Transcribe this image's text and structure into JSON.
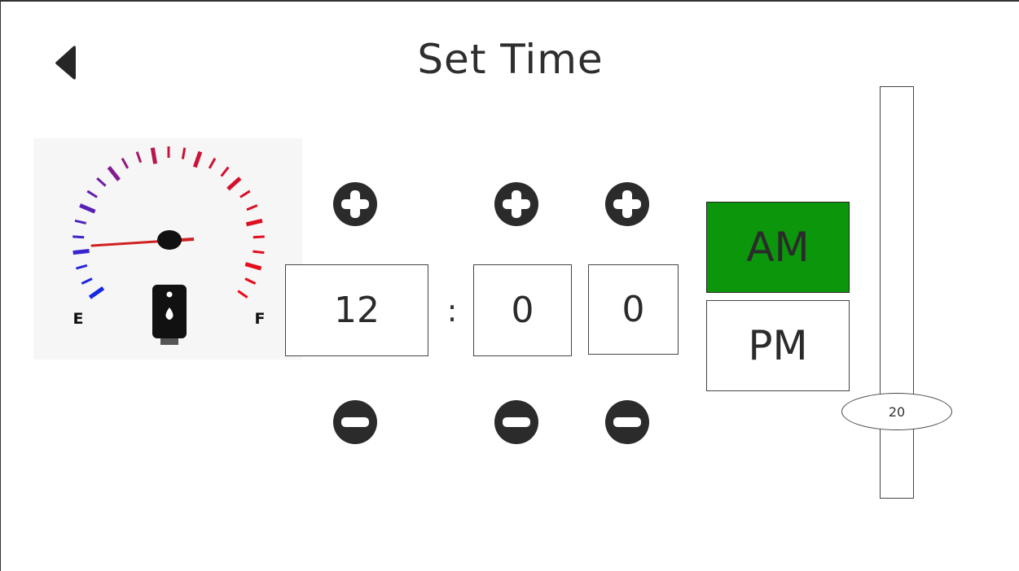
{
  "header": {
    "title": "Set Time",
    "back_icon": "back-arrow-icon"
  },
  "gauge": {
    "empty_label": "E",
    "full_label": "F",
    "icon": "fuel-tank-icon",
    "level": 0.05
  },
  "time": {
    "hour": "12",
    "separator": ":",
    "minute_tens": "0",
    "minute_ones": "0"
  },
  "controls": {
    "plus_icon": "plus-circle-icon",
    "minus_icon": "minus-circle-icon"
  },
  "period": {
    "am_label": "AM",
    "pm_label": "PM",
    "selected": "AM",
    "selected_color": "#0b960b"
  },
  "slider": {
    "value": "20"
  }
}
